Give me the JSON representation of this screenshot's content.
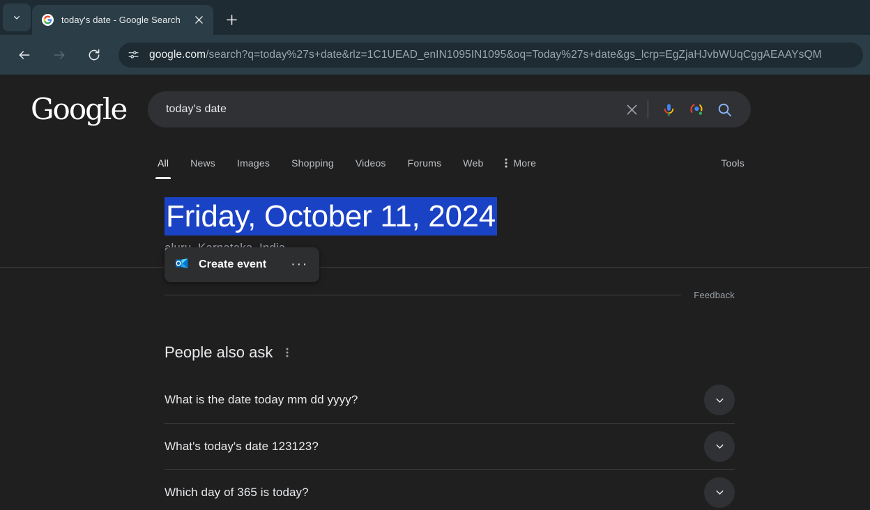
{
  "browser": {
    "tab_search_icon": "chevron-down-icon",
    "tab": {
      "title": "today's date - Google Search",
      "favicon": "google-favicon",
      "close_icon": "close-icon"
    },
    "new_tab_icon": "plus-icon",
    "nav": {
      "back_icon": "arrow-left-icon",
      "forward_icon": "arrow-right-icon",
      "reload_icon": "reload-icon"
    },
    "omnibox": {
      "site_info_icon": "tune-icon",
      "host": "google.com",
      "path": "/search?q=today%27s+date&rlz=1C1UEAD_enIN1095IN1095&oq=Today%27s+date&gs_lcrp=EgZjaHJvbWUqCggAEAAYsQM"
    },
    "colors": {
      "tabstrip": "#1e2b32",
      "toolbar": "#2b3e47",
      "omnibox": "#1e2b32"
    }
  },
  "google": {
    "logo_text": "Google",
    "search": {
      "value": "today's date",
      "placeholder": "Search",
      "clear_icon": "close-icon",
      "mic_icon": "microphone-icon",
      "lens_icon": "google-lens-icon",
      "search_icon": "search-icon"
    },
    "tabs": [
      {
        "label": "All",
        "active": true
      },
      {
        "label": "News",
        "active": false
      },
      {
        "label": "Images",
        "active": false
      },
      {
        "label": "Shopping",
        "active": false
      },
      {
        "label": "Videos",
        "active": false
      },
      {
        "label": "Forums",
        "active": false
      },
      {
        "label": "Web",
        "active": false
      },
      {
        "label": "More",
        "active": false,
        "icon": "more-vert-icon"
      }
    ],
    "tools_label": "Tools"
  },
  "answer": {
    "date": "Friday, October 11, 2024",
    "selection_color": "#1a42c4",
    "location": "aluru, Karnataka, India",
    "create_event": {
      "label": "Create event",
      "icon": "outlook-icon",
      "more_icon": "more-horiz-icon",
      "more_glyph": "···"
    },
    "feedback_label": "Feedback"
  },
  "people_also_ask": {
    "title": "People also ask",
    "menu_icon": "more-vert-icon",
    "menu_glyph": "⋮",
    "questions": [
      {
        "text": "What is the date today mm dd yyyy?",
        "expand_icon": "chevron-down-icon"
      },
      {
        "text": "What's today's date 123123?",
        "expand_icon": "chevron-down-icon"
      },
      {
        "text": "Which day of 365 is today?",
        "expand_icon": "chevron-down-icon"
      }
    ]
  }
}
